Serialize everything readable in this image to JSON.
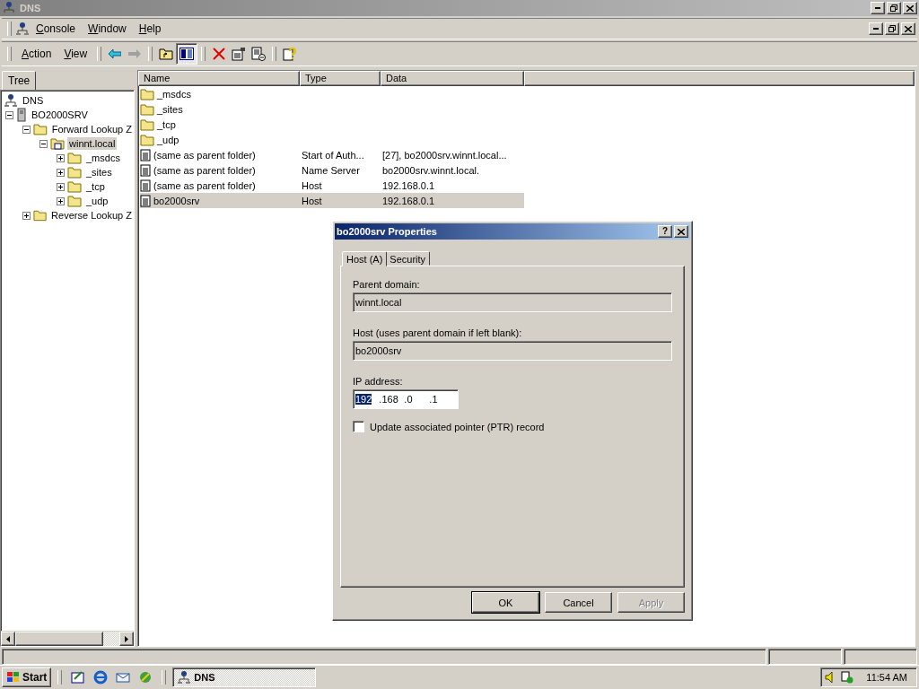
{
  "window": {
    "title": "DNS"
  },
  "menu": [
    "Console",
    "Window",
    "Help"
  ],
  "toolbar": {
    "menus": [
      "Action",
      "View"
    ]
  },
  "tree_tab": {
    "label": "Tree",
    "selected": true
  },
  "tree": [
    {
      "label": "DNS",
      "kind": "root",
      "selected": false,
      "children": [
        {
          "label": "BO2000SRV",
          "kind": "server",
          "expanded": true,
          "selected": false,
          "children": [
            {
              "label": "Forward Lookup Z",
              "kind": "folder",
              "expanded": true,
              "selected": false,
              "children": [
                {
                  "label": "winnt.local",
                  "kind": "zone",
                  "expanded": true,
                  "selected": true,
                  "children": [
                    {
                      "label": "_msdcs",
                      "kind": "folder",
                      "expanded": false,
                      "selected": false
                    },
                    {
                      "label": "_sites",
                      "kind": "folder",
                      "expanded": false,
                      "selected": false
                    },
                    {
                      "label": "_tcp",
                      "kind": "folder",
                      "expanded": false,
                      "selected": false
                    },
                    {
                      "label": "_udp",
                      "kind": "folder",
                      "expanded": false,
                      "selected": false
                    }
                  ]
                }
              ]
            },
            {
              "label": "Reverse Lookup Z",
              "kind": "folder",
              "expanded": false,
              "selected": false
            }
          ]
        }
      ]
    }
  ],
  "table": {
    "columns": [
      "Name",
      "Type",
      "Data"
    ],
    "rows": [
      {
        "kind": "folder",
        "name": "_msdcs",
        "selected": false
      },
      {
        "kind": "folder",
        "name": "_sites",
        "selected": false
      },
      {
        "kind": "folder",
        "name": "_tcp",
        "selected": false
      },
      {
        "kind": "folder",
        "name": "_udp",
        "selected": false
      },
      {
        "kind": "record",
        "name": "(same as parent folder)",
        "type": "Start of Auth...",
        "data": "[27], bo2000srv.winnt.local...",
        "selected": false
      },
      {
        "kind": "record",
        "name": "(same as parent folder)",
        "type": "Name Server",
        "data": "bo2000srv.winnt.local.",
        "selected": false
      },
      {
        "kind": "record",
        "name": "(same as parent folder)",
        "type": "Host",
        "data": "192.168.0.1",
        "selected": false
      },
      {
        "kind": "record",
        "name": "bo2000srv",
        "type": "Host",
        "data": "192.168.0.1",
        "selected": true
      }
    ]
  },
  "dialog": {
    "title": "bo2000srv Properties",
    "help_button": "?",
    "tabs": [
      {
        "label": "Host (A)",
        "selected": true
      },
      {
        "label": "Security",
        "selected": false
      }
    ],
    "fields": [
      {
        "label": "Parent domain:",
        "value": "winnt.local",
        "disabled": true
      },
      {
        "label": "Host (uses parent domain if left blank):",
        "value": "bo2000srv",
        "disabled": true
      }
    ],
    "ip_address": {
      "label": "IP address:",
      "octets": [
        {
          "value": "192",
          "selected": true
        },
        {
          "value": ".168",
          "selected": false
        },
        {
          "value": ".0",
          "selected": false
        },
        {
          "value": ".1",
          "selected": false
        }
      ]
    },
    "checkbox": {
      "label": "Update associated pointer (PTR) record",
      "checked": false
    },
    "buttons": [
      {
        "label": "OK",
        "disabled": false,
        "default": true
      },
      {
        "label": "Cancel",
        "disabled": false,
        "default": false
      },
      {
        "label": "Apply",
        "disabled": true,
        "default": false
      }
    ]
  },
  "taskbar": {
    "start": "Start",
    "tasks": [
      {
        "label": "DNS",
        "selected": true
      }
    ],
    "clock": "11:54 AM"
  }
}
